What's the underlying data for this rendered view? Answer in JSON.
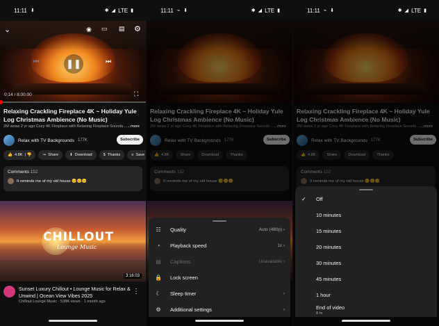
{
  "status": {
    "time": "11:11",
    "network": "LTE"
  },
  "player": {
    "time": "0:14 / 8:00:00"
  },
  "video": {
    "title": "Relaxing Crackling Fireplace 4K ~ Holiday Yule Log Christmas Ambience (No Music)",
    "meta": "2M views  2 yr ago  Cozy 4K Fireplace with Relaxing Fireplace Sounds ...",
    "more": "...more",
    "channel": "Relax with TV Backgrounds",
    "subs": "177K",
    "subscribe": "Subscribe"
  },
  "actions": {
    "likes": "4.8K",
    "share": "Share",
    "download": "Download",
    "thanks": "Thanks",
    "save": "Save"
  },
  "comments": {
    "label": "Comments",
    "count": "152",
    "top": "It reminds me of  my old house 😊😊😊"
  },
  "recommended": {
    "thumb_big": "CHILLOUT",
    "thumb_small": "Lounge Music",
    "duration": "3:16:03",
    "title": "Sunset Luxury Chillout • Lounge Music for Relax & Unwind | Ocean View Vibes 2025",
    "meta": "Chillout Lounge Music · 538K views · 1 month ago"
  },
  "settings": {
    "quality": {
      "label": "Quality",
      "value": "Auto (480p)"
    },
    "speed": {
      "label": "Playback speed",
      "value": "1x"
    },
    "captions": {
      "label": "Captions",
      "value": "Unavailable"
    },
    "lock": {
      "label": "Lock screen"
    },
    "sleep": {
      "label": "Sleep timer"
    },
    "additional": {
      "label": "Additional settings"
    }
  },
  "sleep_timer": {
    "options": [
      "Off",
      "10 minutes",
      "15 minutes",
      "20 minutes",
      "30 minutes",
      "45 minutes",
      "1 hour",
      "End of video"
    ],
    "end_sub": "8 hr",
    "selected": "Off"
  }
}
